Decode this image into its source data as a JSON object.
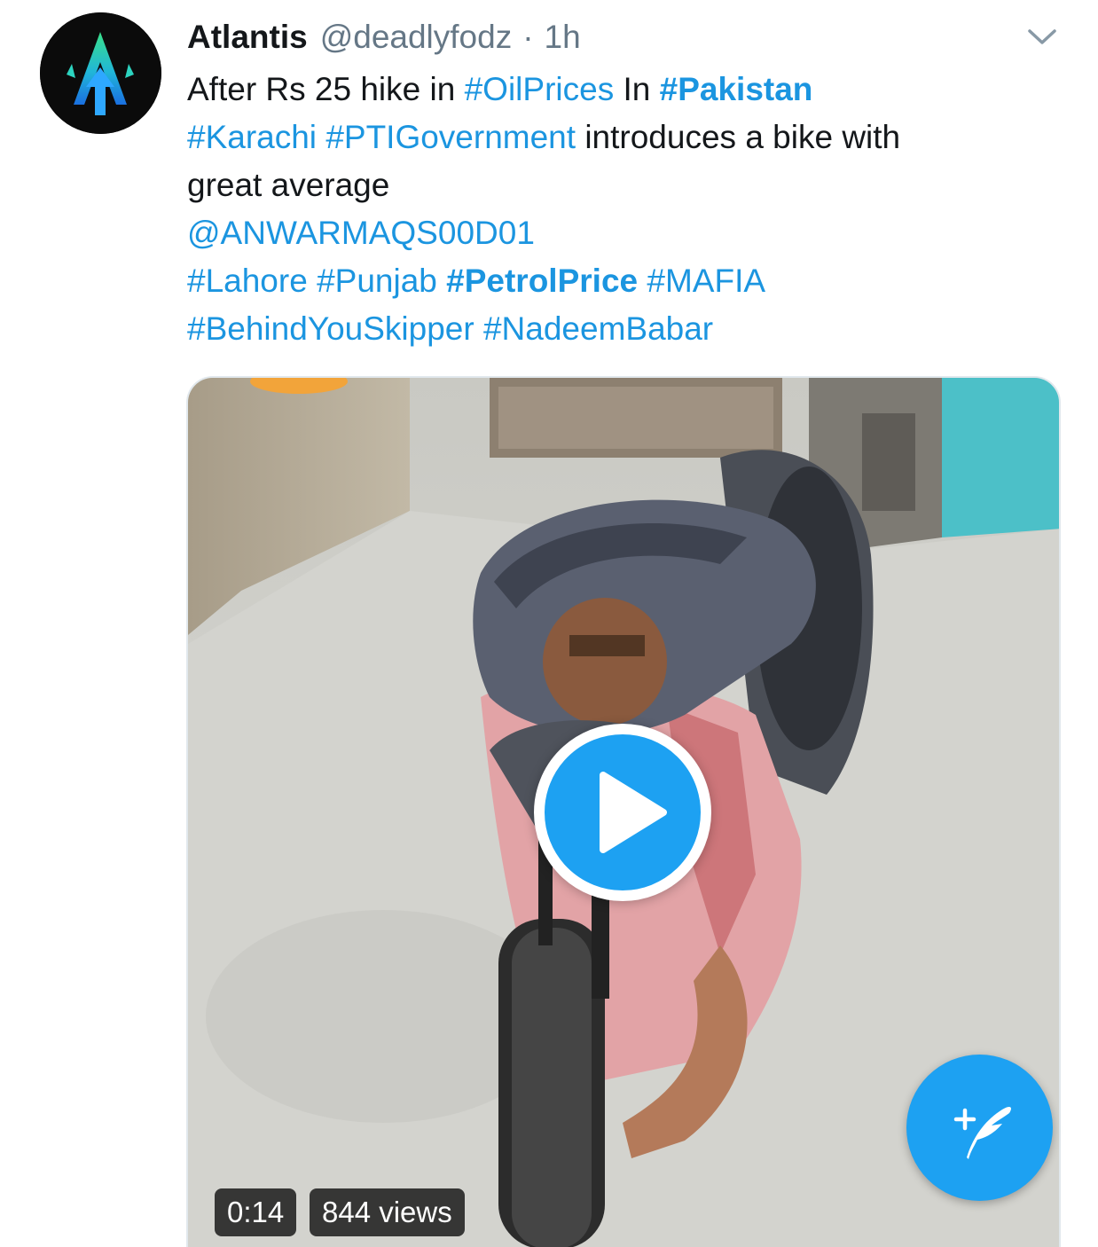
{
  "tweet": {
    "author": {
      "display_name": "Atlantis",
      "handle": "@deadlyfodz",
      "separator": "·",
      "time": "1h",
      "avatar_icon": "atlantis-arrow-logo"
    },
    "menu_icon": "chevron-down-icon",
    "text": {
      "line1": {
        "t1": "After Rs 25 hike in ",
        "tag1": "#OilPrices",
        "t2": " In ",
        "tag2": "#Pakistan"
      },
      "line2": {
        "tag1": "#Karachi",
        "t1": " ",
        "tag2": "#PTIGovernment",
        "t2": " introduces a bike with"
      },
      "line3": {
        "t1": "great average"
      },
      "line4": {
        "mention": "@ANWARMAQS00D01"
      },
      "line5": {
        "tag1": "#Lahore",
        "tag2": "#Punjab",
        "tag3": "#PetrolPrice",
        "tag4": "#MAFIA"
      },
      "line6": {
        "tag1": "#BehindYouSkipper",
        "tag2": "#NadeemBabar"
      }
    },
    "media": {
      "type": "video",
      "duration": "0:14",
      "views": "844 views",
      "play_icon": "play-icon"
    }
  },
  "compose_button": {
    "icon": "compose-tweet-icon"
  },
  "colors": {
    "link": "#1b95e0",
    "accent": "#1da1f2",
    "secondary_text": "#657786",
    "primary_text": "#14171a"
  }
}
